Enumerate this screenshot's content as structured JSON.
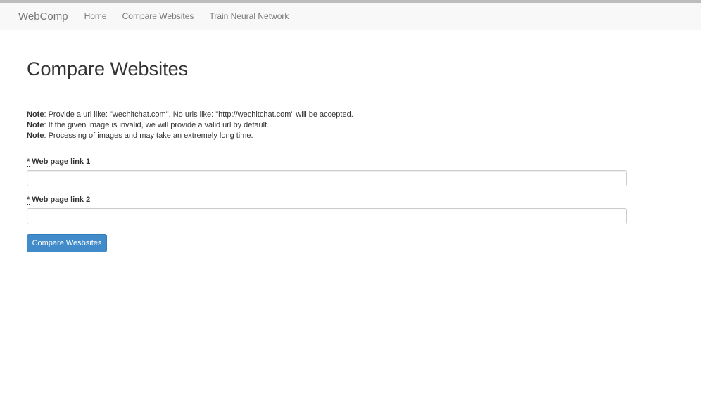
{
  "navbar": {
    "brand": "WebComp",
    "links": [
      "Home",
      "Compare Websites",
      "Train Neural Network"
    ]
  },
  "main": {
    "title": "Compare Websites",
    "notes": [
      {
        "label": "Note",
        "text": ": Provide a url like: \"wechitchat.com\". No urls like: \"http://wechitchat.com\" will be accepted."
      },
      {
        "label": "Note",
        "text": ": If the given image is invalid, we will provide a valid url by default."
      },
      {
        "label": "Note",
        "text": ": Processing of images and may take an extremely long time."
      }
    ],
    "fields": [
      {
        "required_mark": "*",
        "label": "Web page link 1",
        "value": ""
      },
      {
        "required_mark": "*",
        "label": "Web page link 2",
        "value": ""
      }
    ],
    "submit_label": "Compare Wesbsites"
  },
  "colors": {
    "primary_button": "#428bca",
    "navbar_bg": "#f8f8f8"
  }
}
